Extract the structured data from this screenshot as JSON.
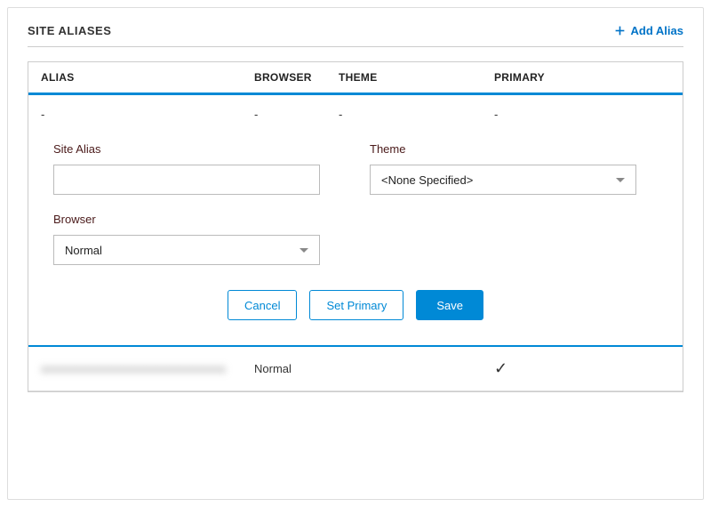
{
  "header": {
    "title": "SITE ALIASES",
    "add_alias_label": "Add Alias"
  },
  "columns": {
    "alias": "ALIAS",
    "browser": "BROWSER",
    "theme": "THEME",
    "primary": "PRIMARY"
  },
  "dash_row": {
    "alias": "-",
    "browser": "-",
    "theme": "-",
    "primary": "-"
  },
  "form": {
    "site_alias_label": "Site Alias",
    "site_alias_value": "",
    "theme_label": "Theme",
    "theme_value": "<None Specified>",
    "browser_label": "Browser",
    "browser_value": "Normal"
  },
  "buttons": {
    "cancel": "Cancel",
    "set_primary": "Set Primary",
    "save": "Save"
  },
  "existing_row": {
    "alias_masked": "xxxxxxxxxxxxxxxxxxxxxxxxxxxxxxxx",
    "browser": "Normal",
    "primary_check": "✓"
  }
}
